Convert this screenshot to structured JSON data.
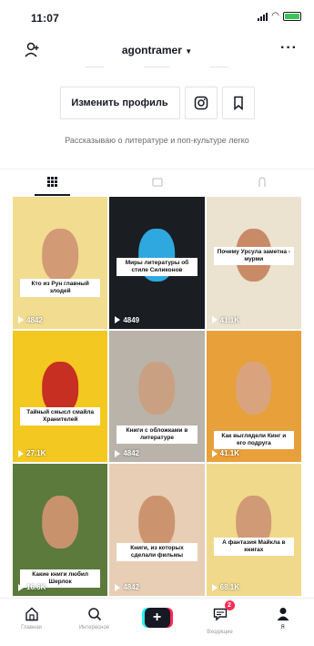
{
  "status": {
    "time": "11:07",
    "battery_color": "#3ec45a"
  },
  "header": {
    "username": "agontramer",
    "more": "···"
  },
  "actions": {
    "edit_profile": "Изменить профиль"
  },
  "bio": "Рассказываю о литературе и поп-культуре легко",
  "tabs": [
    {
      "name": "videos",
      "icon": "grid-icon",
      "active": true
    },
    {
      "name": "private",
      "icon": "lock-icon",
      "active": false
    },
    {
      "name": "liked",
      "icon": "heart-icon",
      "active": false
    }
  ],
  "videos": [
    {
      "caption": "Кто из Рун главный злодей",
      "views": "4842",
      "bg": "#f1dc8f",
      "face": "#d39a76",
      "cap_pos": "62%"
    },
    {
      "caption": "Миры литературы об стиле Силиконов",
      "views": "4849",
      "bg": "#1a1d22",
      "face": "#2fa8e0",
      "cap_pos": "46%"
    },
    {
      "caption": "Почему Урсула заметна - мурми",
      "views": "41.1K",
      "bg": "#ebe2cf",
      "face": "#c98a67",
      "cap_pos": "38%"
    },
    {
      "caption": "Тайный смысл смайла Хранителей",
      "views": "27.1K",
      "bg": "#f3c820",
      "face": "#c62f22",
      "cap_pos": "58%"
    },
    {
      "caption": "Книги с обложками в литературе",
      "views": "4842",
      "bg": "#b9b3aa",
      "face": "#caa083",
      "cap_pos": "72%"
    },
    {
      "caption": "Как выглядели Кинг и его подруга",
      "views": "41.1K",
      "bg": "#e8a03a",
      "face": "#d9a47d",
      "cap_pos": "76%"
    },
    {
      "caption": "Какие книги любил Шерлок",
      "views": "16.6K",
      "bg": "#5b7a3c",
      "face": "#c8926c",
      "cap_pos": "80%"
    },
    {
      "caption": "Книги, из которых сделали фильмы",
      "views": "4842",
      "bg": "#e7ceb5",
      "face": "#cc936f",
      "cap_pos": "60%"
    },
    {
      "caption": "А фантазия Майкла в книгах",
      "views": "68.1K",
      "bg": "#f0d98a",
      "face": "#cf9a75",
      "cap_pos": "56%"
    }
  ],
  "bottom_nav": [
    {
      "name": "home",
      "label": "Главная",
      "active": false
    },
    {
      "name": "discover",
      "label": "Интересное",
      "active": false
    },
    {
      "name": "create",
      "label": "",
      "active": false
    },
    {
      "name": "inbox",
      "label": "Входящие",
      "active": false,
      "badge": "2"
    },
    {
      "name": "profile",
      "label": "Я",
      "active": true
    }
  ]
}
